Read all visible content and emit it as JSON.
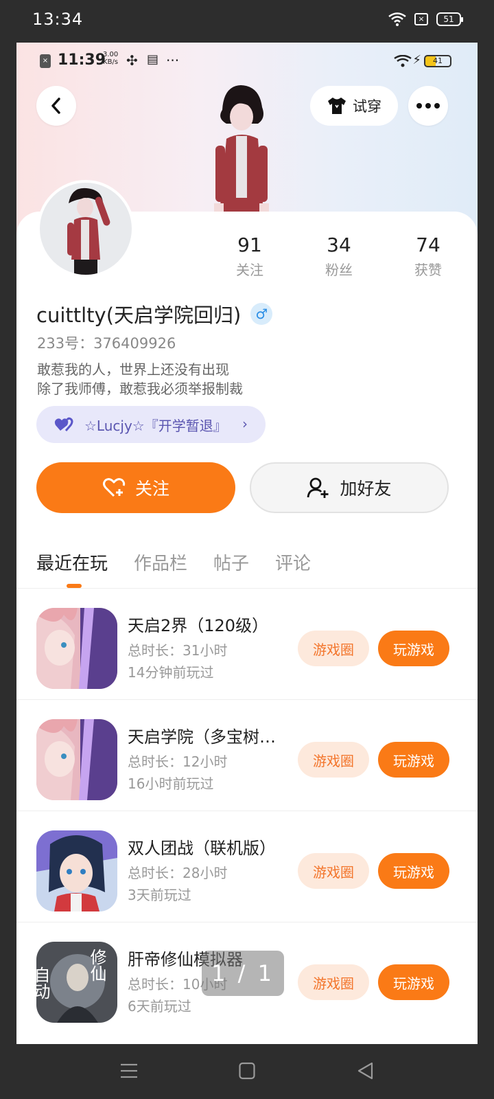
{
  "outer_status": {
    "time": "13:34",
    "battery": "51",
    "x_icon": "×"
  },
  "inner_status": {
    "time": "11:39",
    "speed_value": "3.00",
    "speed_unit": "KB/s",
    "battery": "41",
    "dots": "···"
  },
  "header": {
    "try_on_label": "试穿"
  },
  "stats": [
    {
      "value": "91",
      "label": "关注"
    },
    {
      "value": "34",
      "label": "粉丝"
    },
    {
      "value": "74",
      "label": "获赞"
    }
  ],
  "profile": {
    "username": "cuittlty(天启学院回归)",
    "gender_symbol": "♂",
    "uid": "233号：376409926",
    "bio_line1": "敢惹我的人，世界上还没有出现",
    "bio_line2": "除了我师傅，敢惹我必须举报制裁",
    "guild": "☆Lucjy☆『开学暂退』"
  },
  "actions": {
    "follow": "关注",
    "add_friend": "加好友"
  },
  "tabs": [
    "最近在玩",
    "作品栏",
    "帖子",
    "评论"
  ],
  "games": [
    {
      "title": "天启2界（120级）",
      "duration": "总时长：31小时",
      "last_played": "14分钟前玩过",
      "circle": "游戏圈",
      "play": "玩游戏"
    },
    {
      "title": "天启学院（多宝树…",
      "duration": "总时长：12小时",
      "last_played": "16小时前玩过",
      "circle": "游戏圈",
      "play": "玩游戏"
    },
    {
      "title": "双人团战（联机版）",
      "duration": "总时长：28小时",
      "last_played": "3天前玩过",
      "circle": "游戏圈",
      "play": "玩游戏"
    },
    {
      "title": "肝帝修仙模拟器",
      "duration": "总时长：10小时",
      "last_played": "6天前玩过",
      "circle": "游戏圈",
      "play": "玩游戏"
    }
  ],
  "game4_icon_text": {
    "left": "自动",
    "right": "修仙"
  },
  "pager": "1 / 1",
  "colors": {
    "accent": "#fa7a16",
    "accent_light": "#fde9dc",
    "guild_bg": "#e8e8fa"
  }
}
